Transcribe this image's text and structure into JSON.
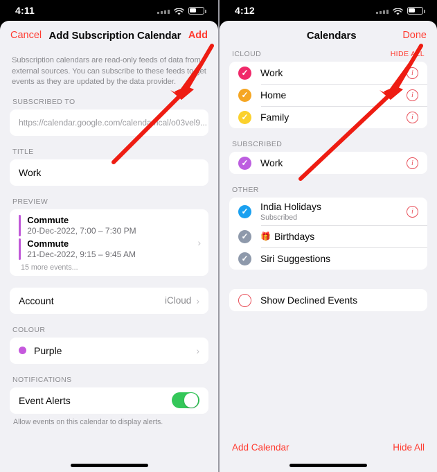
{
  "left": {
    "status": {
      "time": "4:11"
    },
    "nav": {
      "cancel": "Cancel",
      "title": "Add Subscription Calendar",
      "add": "Add"
    },
    "description": "Subscription calendars are read-only feeds of data from external sources. You can subscribe to these feeds to get events as they are updated by the data provider.",
    "subscribed_to": {
      "label": "SUBSCRIBED TO",
      "url": "https://calendar.google.com/calendar/ical/o03vel9..."
    },
    "title_field": {
      "label": "TITLE",
      "value": "Work"
    },
    "preview": {
      "label": "PREVIEW",
      "events": [
        {
          "title": "Commute",
          "detail": "20-Dec-2022, 7:00 – 7:30 PM",
          "color": "#c058d8"
        },
        {
          "title": "Commute",
          "detail": "21-Dec-2022, 9:15 – 9:45 AM",
          "color": "#c058d8"
        }
      ],
      "more": "15 more events...",
      "chevron": "›"
    },
    "account": {
      "label": "Account",
      "value": "iCloud",
      "chevron": "›"
    },
    "colour": {
      "label": "COLOUR",
      "value": "Purple",
      "swatch": "#c558dd",
      "chevron": "›"
    },
    "notifications": {
      "label": "NOTIFICATIONS",
      "row": "Event Alerts",
      "toggle_on": true,
      "note": "Allow events on this calendar to display alerts."
    }
  },
  "right": {
    "status": {
      "time": "4:12"
    },
    "nav": {
      "title": "Calendars",
      "done": "Done"
    },
    "sections": [
      {
        "label": "ICLOUD",
        "action": "HIDE ALL",
        "items": [
          {
            "name": "Work",
            "checked": true,
            "color": "#f0296a",
            "info": true
          },
          {
            "name": "Home",
            "checked": true,
            "color": "#f5a623",
            "info": true
          },
          {
            "name": "Family",
            "checked": true,
            "color": "#fbd12d",
            "info": true
          }
        ]
      },
      {
        "label": "SUBSCRIBED",
        "items": [
          {
            "name": "Work",
            "checked": true,
            "color": "#bd5ee0",
            "info": true
          }
        ]
      },
      {
        "label": "OTHER",
        "items": [
          {
            "name": "India Holidays",
            "sub": "Subscribed",
            "checked": true,
            "color": "#1aa0f0",
            "info": true
          },
          {
            "name": "Birthdays",
            "checked": true,
            "color": "#8e99ab",
            "icon": "gift-icon",
            "glyph": "🎁",
            "info": false
          },
          {
            "name": "Siri Suggestions",
            "checked": true,
            "color": "#8e99ab",
            "info": false
          }
        ]
      }
    ],
    "declined": {
      "label": "Show Declined Events",
      "checked": false
    },
    "footer": {
      "add_calendar": "Add Calendar",
      "hide_all": "Hide All"
    }
  },
  "check_glyph": "✓"
}
